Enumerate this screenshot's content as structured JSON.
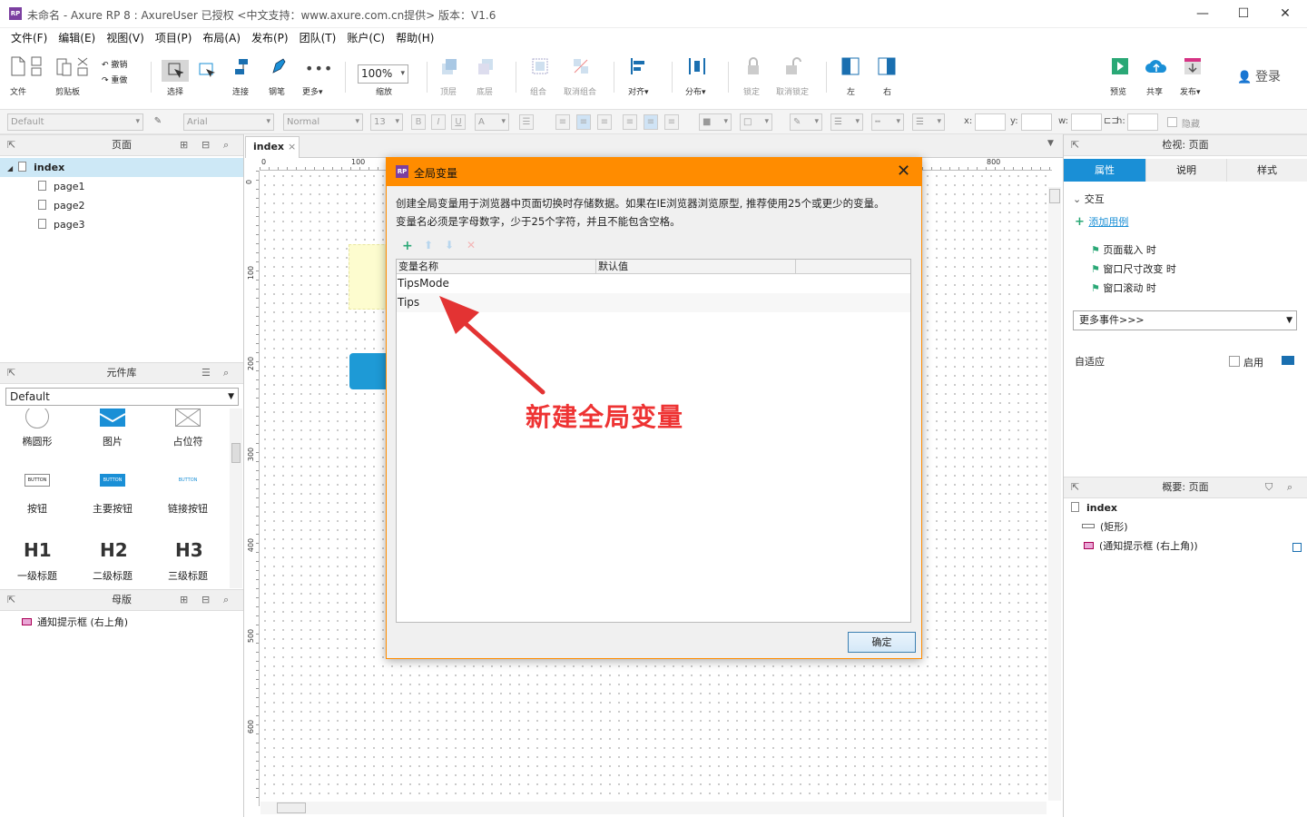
{
  "window": {
    "title": "未命名 - Axure RP 8 : AxureUser 已授权    <中文支持：www.axure.com.cn提供> 版本：V1.6",
    "app_icon": "RP",
    "minimize": "—",
    "maximize": "☐",
    "close": "✕"
  },
  "menu": [
    "文件(F)",
    "编辑(E)",
    "视图(V)",
    "项目(P)",
    "布局(A)",
    "发布(P)",
    "团队(T)",
    "账户(C)",
    "帮助(H)"
  ],
  "toolbar": {
    "file": "文件",
    "clipboard": "剪贴板",
    "undo": "撤销",
    "redo": "重做",
    "select": "选择",
    "connect": "连接",
    "pen": "钢笔",
    "more": "更多▾",
    "zoom_value": "100%",
    "zoom": "缩放",
    "top": "顶层",
    "bottom": "底层",
    "group": "组合",
    "ungroup": "取消组合",
    "align": "对齐▾",
    "distribute": "分布▾",
    "lock": "锁定",
    "unlock": "取消锁定",
    "left": "左",
    "right": "右",
    "preview": "预览",
    "share": "共享",
    "publish": "发布▾",
    "login": "登录"
  },
  "formatbar": {
    "style": "Default",
    "font": "Arial",
    "weight": "Normal",
    "size": "13",
    "x": "x:",
    "y": "y:",
    "w": "w:",
    "h": "h:",
    "hidden": "隐藏"
  },
  "pages_panel": {
    "title": "页面",
    "items": [
      "index",
      "page1",
      "page2",
      "page3"
    ]
  },
  "library_panel": {
    "title": "元件库",
    "selected": "Default",
    "widgets": [
      {
        "label": "椭圆形"
      },
      {
        "label": "图片"
      },
      {
        "label": "占位符"
      },
      {
        "label": "按钮",
        "glyph": "BUTTON"
      },
      {
        "label": "主要按钮",
        "glyph": "BUTTON"
      },
      {
        "label": "链接按钮",
        "glyph": "BUTTON"
      },
      {
        "label": "一级标题",
        "glyph": "H1"
      },
      {
        "label": "二级标题",
        "glyph": "H2"
      },
      {
        "label": "三级标题",
        "glyph": "H3"
      }
    ]
  },
  "masters_panel": {
    "title": "母版",
    "items": [
      "通知提示框 (右上角)"
    ]
  },
  "canvas": {
    "tab": "index",
    "tab_close": "×",
    "ruler_h": [
      "0",
      "100",
      "800"
    ],
    "ruler_v": [
      "0",
      "100",
      "200",
      "300",
      "400",
      "500",
      "600"
    ],
    "colors": {
      "note": "#fdfccf",
      "button": "#1e9ad6"
    }
  },
  "inspector": {
    "title": "检视: 页面",
    "tabs": [
      "属性",
      "说明",
      "样式"
    ],
    "interaction": "交互",
    "add_case": "添加用例",
    "events": [
      "页面载入 时",
      "窗口尺寸改变 时",
      "窗口滚动 时"
    ],
    "more_events": "更多事件>>>",
    "adaptive": "自适应",
    "enable": "启用",
    "accent": "#1a8fd6"
  },
  "outline": {
    "title": "概要: 页面",
    "root": "index",
    "items": [
      "(矩形)",
      "(通知提示框 (右上角))"
    ]
  },
  "dialog": {
    "title": "全局变量",
    "description_1": "创建全局变量用于浏览器中页面切换时存储数据。如果在IE浏览器浏览原型, 推荐使用25个或更少的变量。",
    "description_2": "变量名必须是字母数字，少于25个字符，并且不能包含空格。",
    "columns": [
      "变量名称",
      "默认值"
    ],
    "rows": [
      "TipsMode",
      "Tips"
    ],
    "ok": "确定",
    "close": "✕",
    "accent": "#ff8c00"
  },
  "annotation": {
    "text": "新建全局变量",
    "color": "#e33333"
  }
}
